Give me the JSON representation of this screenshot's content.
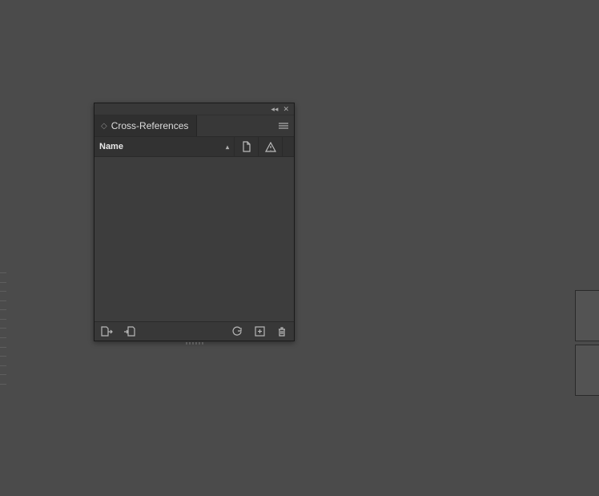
{
  "panel": {
    "tab_label": "Cross-References",
    "columns": {
      "name_label": "Name"
    }
  }
}
